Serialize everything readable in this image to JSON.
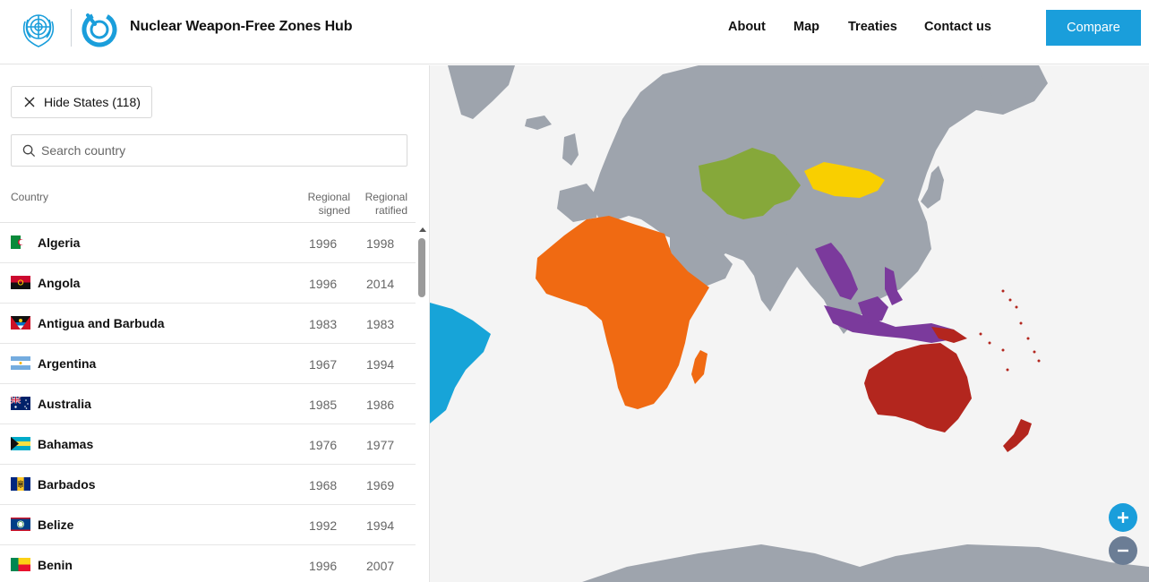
{
  "header": {
    "title": "Nuclear Weapon-Free Zones Hub",
    "nav": [
      "About",
      "Map",
      "Treaties",
      "Contact us"
    ],
    "compare_label": "Compare"
  },
  "sidebar": {
    "hide_label": "Hide States (118)",
    "search_placeholder": "Search country",
    "columns": {
      "country": "Country",
      "signed_1": "Regional",
      "signed_2": "signed",
      "ratified_1": "Regional",
      "ratified_2": "ratified"
    },
    "rows": [
      {
        "name": "Algeria",
        "signed": "1996",
        "ratified": "1998"
      },
      {
        "name": "Angola",
        "signed": "1996",
        "ratified": "2014"
      },
      {
        "name": "Antigua and Barbuda",
        "signed": "1983",
        "ratified": "1983"
      },
      {
        "name": "Argentina",
        "signed": "1967",
        "ratified": "1994"
      },
      {
        "name": "Australia",
        "signed": "1985",
        "ratified": "1986"
      },
      {
        "name": "Bahamas",
        "signed": "1976",
        "ratified": "1977"
      },
      {
        "name": "Barbados",
        "signed": "1968",
        "ratified": "1969"
      },
      {
        "name": "Belize",
        "signed": "1992",
        "ratified": "1994"
      },
      {
        "name": "Benin",
        "signed": "1996",
        "ratified": "2007"
      }
    ]
  },
  "colors": {
    "accent": "#1a9edb",
    "land_gray": "#9ea4ad",
    "africa": "#f06a12",
    "latin_america": "#17a4d8",
    "central_asia": "#86a83a",
    "mongolia": "#f9cf00",
    "southeast_asia": "#7b3a9c",
    "south_pacific": "#b3261e",
    "zoom_out": "#6b7d95"
  },
  "icons": {
    "close": "close-icon",
    "search": "search-icon",
    "zoom_in": "plus-icon",
    "zoom_out": "minus-icon"
  }
}
